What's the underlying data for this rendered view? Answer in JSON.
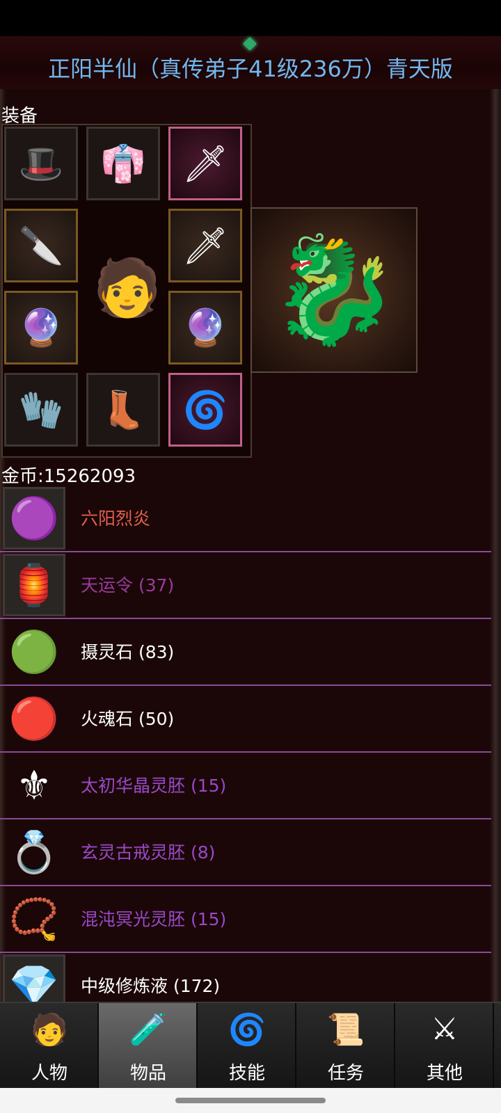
{
  "header": {
    "title": "正阳半仙（真传弟子41级236万）青天版"
  },
  "equipment": {
    "label": "装备",
    "slots": [
      {
        "name": "helmet",
        "icon": "🎩"
      },
      {
        "name": "armor",
        "icon": "👘"
      },
      {
        "name": "weapon-special",
        "icon": "🗡"
      },
      {
        "name": "weapon-left",
        "icon": "🔪"
      },
      {
        "name": "weapon-right",
        "icon": "🗡"
      },
      {
        "name": "bracer-left",
        "icon": "🔮"
      },
      {
        "name": "bracer-right",
        "icon": "🔮"
      },
      {
        "name": "gauntlet",
        "icon": "🧤"
      },
      {
        "name": "boots",
        "icon": "👢"
      },
      {
        "name": "orb",
        "icon": "🌀"
      }
    ],
    "avatar_icon": "🧑",
    "pet_icon": "🐉"
  },
  "gold": {
    "text": "金币:15262093"
  },
  "items": [
    {
      "name": "六阳烈炎",
      "color": "#e0604c",
      "icon": "🟣",
      "boxed": true
    },
    {
      "name": "天运令 (37)",
      "color": "#9a3aa0",
      "icon": "🏮",
      "boxed": true
    },
    {
      "name": "摄灵石 (83)",
      "color": "#ffffff",
      "icon": "🟢",
      "boxed": false
    },
    {
      "name": "火魂石 (50)",
      "color": "#ffffff",
      "icon": "🔴",
      "boxed": false
    },
    {
      "name": "太初华晶灵胚 (15)",
      "color": "#9a48c8",
      "icon": "⚜",
      "boxed": false
    },
    {
      "name": "玄灵古戒灵胚 (8)",
      "color": "#9a48c8",
      "icon": "💍",
      "boxed": false
    },
    {
      "name": "混沌冥光灵胚 (15)",
      "color": "#9a48c8",
      "icon": "📿",
      "boxed": false
    },
    {
      "name": "中级修炼液 (172)",
      "color": "#ffffff",
      "icon": "💎",
      "boxed": true
    }
  ],
  "tabs": [
    {
      "label": "人物",
      "icon": "🧑",
      "active": false
    },
    {
      "label": "物品",
      "icon": "🧪",
      "active": true
    },
    {
      "label": "技能",
      "icon": "🌀",
      "active": false
    },
    {
      "label": "任务",
      "icon": "📜",
      "active": false
    },
    {
      "label": "其他",
      "icon": "⚔",
      "active": false
    }
  ]
}
